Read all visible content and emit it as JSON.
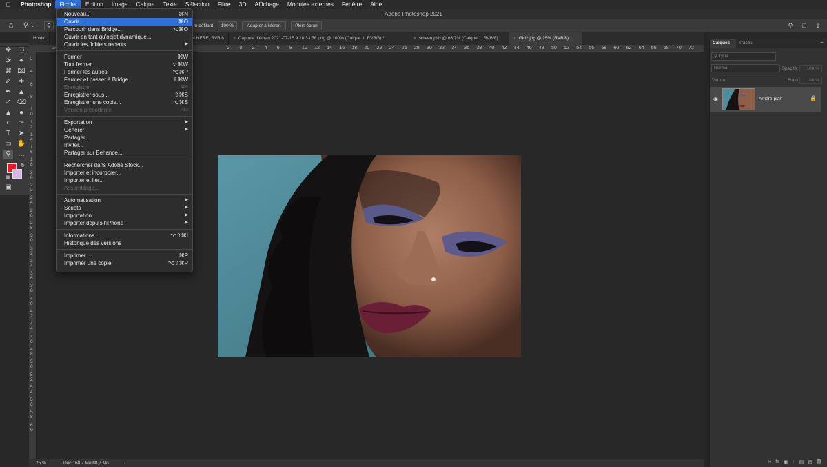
{
  "menubar": {
    "apple": "",
    "items": [
      {
        "label": "Photoshop"
      },
      {
        "label": "Fichier"
      },
      {
        "label": "Edition"
      },
      {
        "label": "Image"
      },
      {
        "label": "Calque"
      },
      {
        "label": "Texte"
      },
      {
        "label": "Sélection"
      },
      {
        "label": "Filtre"
      },
      {
        "label": "3D"
      },
      {
        "label": "Affichage"
      },
      {
        "label": "Modules externes"
      },
      {
        "label": "Fenêtre"
      },
      {
        "label": "Aide"
      }
    ]
  },
  "window": {
    "title": "Adobe Photoshop 2021"
  },
  "options": {
    "defilant": "m défilant",
    "zoom100": "100 %",
    "adapter": "Adapter à l'écran",
    "plein": "Plein écran"
  },
  "tabs": [
    {
      "label": "Holdin"
    },
    {
      "label": "EEN HERE, RVB/8) *"
    },
    {
      "label": "Capture d'écran 2021-07-15 à 10.33.36.png @ 100% (Calque 1, RVB/8) *"
    },
    {
      "label": "screen.psb @ 66,7% (Calque 1, RVB/8)"
    },
    {
      "label": "Girl2.jpg @ 25% (RVB/8)"
    }
  ],
  "hruler_ticks": [
    "24",
    "",
    "",
    "",
    "",
    "",
    "",
    "",
    "",
    "",
    "",
    "",
    "",
    "",
    "2",
    "0",
    "2",
    "4",
    "6",
    "8",
    "10",
    "12",
    "14",
    "16",
    "18",
    "20",
    "22",
    "24",
    "26",
    "28",
    "30",
    "32",
    "34",
    "36",
    "38",
    "40",
    "42",
    "44",
    "46",
    "48",
    "50",
    "52",
    "54",
    "56",
    "58",
    "60",
    "62",
    "64",
    "66",
    "68",
    "70",
    "72"
  ],
  "vruler_ticks": [
    "2",
    "4",
    "6",
    "8",
    "1 0",
    "1 2",
    "1 4",
    "1 6",
    "1 8",
    "2 0",
    "2 2",
    "2 4",
    "2 6",
    "2 8",
    "3 0",
    "3 2",
    "3 4",
    "3 6",
    "3 8",
    "4 0",
    "4 2",
    "4 4",
    "4 6",
    "4 8",
    "5 0",
    "5 2",
    "5 4",
    "5 6",
    "5 8",
    "6 0"
  ],
  "status": {
    "zoom": "25 %",
    "doc": "Doc : 68,7 Mo/68,7 Mo"
  },
  "panel": {
    "tabs": [
      {
        "label": "Calques"
      },
      {
        "label": "Tracés"
      }
    ],
    "search_placeholder": "Type",
    "blend_mode": "Normal",
    "opacity_label": "Opacité :",
    "opacity_value": "100 %",
    "lock_label": "Verrou :",
    "fill_label": "Fond :",
    "fill_value": "100 %",
    "layer_name": "Arrière-plan"
  },
  "fichier_menu": {
    "groups": [
      [
        {
          "label": "Nouveau...",
          "shortcut": "⌘N"
        },
        {
          "label": "Ouvrir...",
          "shortcut": "⌘O",
          "highlight": true
        },
        {
          "label": "Parcourir dans Bridge...",
          "shortcut": "⌥⌘O"
        },
        {
          "label": "Ouvrir en tant qu'objet dynamique..."
        },
        {
          "label": "Ouvrir les fichiers récents",
          "submenu": true
        }
      ],
      [
        {
          "label": "Fermer",
          "shortcut": "⌘W"
        },
        {
          "label": "Tout fermer",
          "shortcut": "⌥⌘W"
        },
        {
          "label": "Fermer les autres",
          "shortcut": "⌥⌘P"
        },
        {
          "label": "Fermer et passer à Bridge...",
          "shortcut": "⇧⌘W"
        },
        {
          "label": "Enregistrer",
          "shortcut": "⌘S",
          "disabled": true
        },
        {
          "label": "Enregistrer sous...",
          "shortcut": "⇧⌘S"
        },
        {
          "label": "Enregistrer une copie...",
          "shortcut": "⌥⌘S"
        },
        {
          "label": "Version précédente",
          "shortcut": "F12",
          "disabled": true
        }
      ],
      [
        {
          "label": "Exportation",
          "submenu": true
        },
        {
          "label": "Générer",
          "submenu": true
        },
        {
          "label": "Partager..."
        },
        {
          "label": "Inviter..."
        },
        {
          "label": "Partager sur Behance..."
        }
      ],
      [
        {
          "label": "Rechercher dans Adobe Stock..."
        },
        {
          "label": "Importer et incorporer..."
        },
        {
          "label": "Importer et lier..."
        },
        {
          "label": "Assemblage...",
          "disabled": true
        }
      ],
      [
        {
          "label": "Automatisation",
          "submenu": true
        },
        {
          "label": "Scripts",
          "submenu": true
        },
        {
          "label": "Importation",
          "submenu": true
        },
        {
          "label": "Importer depuis l'iPhone",
          "submenu": true
        }
      ],
      [
        {
          "label": "Informations...",
          "shortcut": "⌥⇧⌘I"
        },
        {
          "label": "Historique des versions"
        }
      ],
      [
        {
          "label": "Imprimer...",
          "shortcut": "⌘P"
        },
        {
          "label": "Imprimer une copie",
          "shortcut": "⌥⇧⌘P"
        }
      ]
    ]
  },
  "colors": {
    "accent": "#2f6fd6",
    "foreground": "#e01b24",
    "background": "#d7b6e4"
  }
}
